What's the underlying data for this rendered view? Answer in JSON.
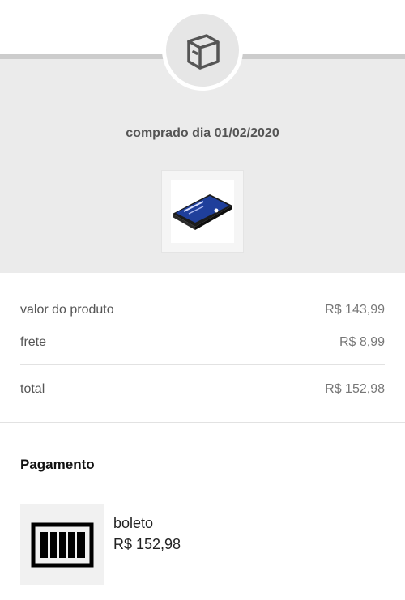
{
  "header": {
    "icon": "box-icon",
    "purchase_date": "comprado dia 01/02/2020",
    "product_image": "ssd-drive-image",
    "colors": {
      "background": "#ebebeb",
      "badge": "#e6e6e6",
      "icon_stroke": "#555555"
    }
  },
  "summary": {
    "product_label": "valor do produto",
    "product_value": "R$ 143,99",
    "shipping_label": "frete",
    "shipping_value": "R$ 8,99",
    "total_label": "total",
    "total_value": "R$ 152,98"
  },
  "payment": {
    "title": "Pagamento",
    "icon": "barcode-icon",
    "method": "boleto",
    "amount": "R$ 152,98"
  }
}
